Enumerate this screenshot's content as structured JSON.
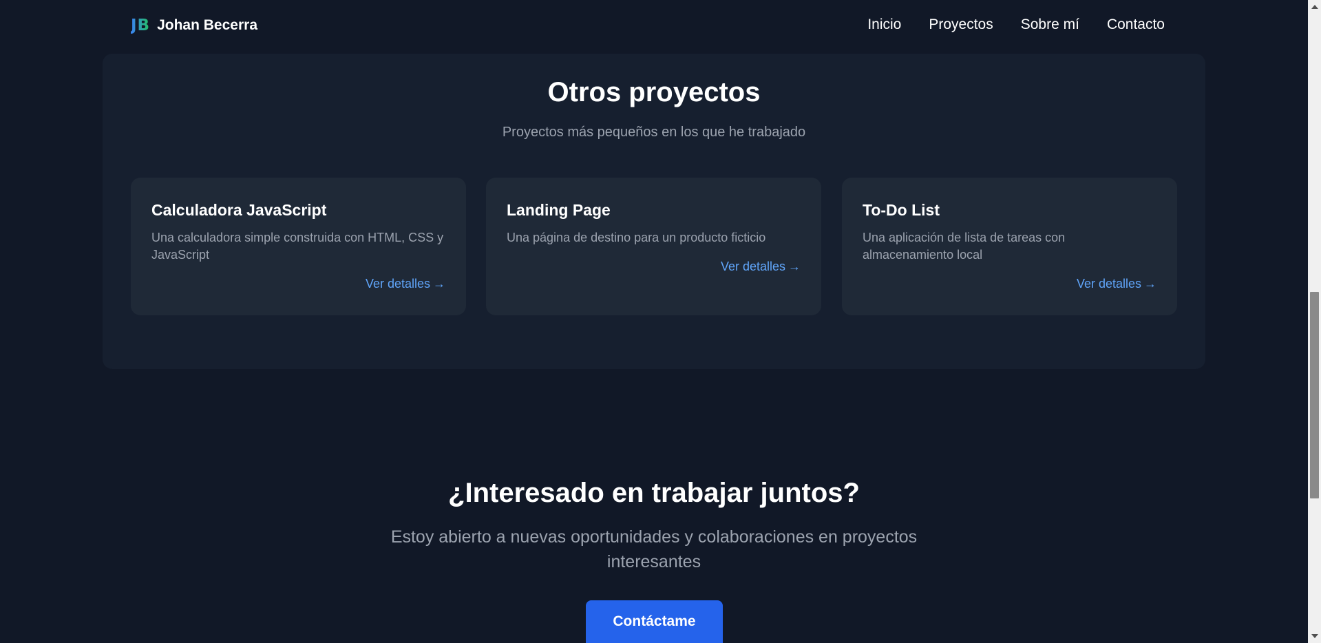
{
  "header": {
    "logo_mark": "JB",
    "logo_name": "Johan Becerra",
    "nav": [
      "Inicio",
      "Proyectos",
      "Sobre mí",
      "Contacto"
    ]
  },
  "projects": {
    "title": "Otros proyectos",
    "subtitle": "Proyectos más pequeños en los que he trabajado",
    "cards": [
      {
        "title": "Calculadora JavaScript",
        "description": "Una calculadora simple construida con HTML, CSS y JavaScript",
        "link": "Ver detalles",
        "arrow": "→"
      },
      {
        "title": "Landing Page",
        "description": "Una página de destino para un producto ficticio",
        "link": "Ver detalles",
        "arrow": "→"
      },
      {
        "title": "To-Do List",
        "description": "Una aplicación de lista de tareas con almacenamiento local",
        "link": "Ver detalles",
        "arrow": "→"
      }
    ]
  },
  "cta": {
    "title": "¿Interesado en trabajar juntos?",
    "subtitle": "Estoy abierto a nuevas oportunidades y colaboraciones en proyectos interesantes",
    "button": "Contáctame"
  },
  "colors": {
    "background": "#111827",
    "panel": "#161f2f",
    "card": "#1f2937",
    "link": "#60a5fa",
    "button": "#2563eb"
  }
}
